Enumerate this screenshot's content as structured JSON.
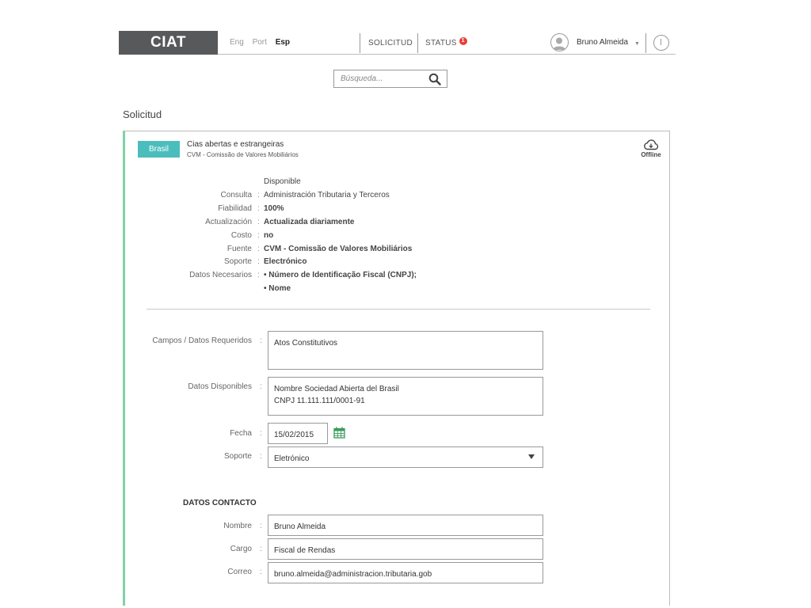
{
  "header": {
    "logo": "CIAT",
    "languages": [
      {
        "label": "Eng",
        "active": false
      },
      {
        "label": "Port",
        "active": false
      },
      {
        "label": "Esp",
        "active": true
      }
    ],
    "nav": {
      "solicitud": "SOLICITUD",
      "status": "STATUS",
      "status_badge": "1"
    },
    "user_name": "Bruno Almeida",
    "user_caret": "▼"
  },
  "search": {
    "placeholder": "Búsqueda..."
  },
  "page_title": "Solicitud",
  "card": {
    "country": "Brasil",
    "source_title": "Cias abertas e estrangeiras",
    "source_subtitle": "CVM - Comissão de Valores Mobiliários",
    "offline_label": "Offline",
    "availability": "Disponible",
    "details": [
      {
        "label": "Consulta",
        "value": "Administración Tributaria y Terceros",
        "bold": false
      },
      {
        "label": "Fiabilidad",
        "value": "100%",
        "bold": true
      },
      {
        "label": "Actualización",
        "value": "Actualizada diariamente",
        "bold": true
      },
      {
        "label": "Costo",
        "value": "no",
        "bold": true
      },
      {
        "label": "Fuente",
        "value": "CVM - Comissão de Valores Mobiliários",
        "bold": true
      },
      {
        "label": "Soporte",
        "value": "Electrónico",
        "bold": true
      },
      {
        "label": "Datos Necesarios",
        "value": "• Número de Identificação Fiscal (CNPJ);",
        "bold": true
      }
    ],
    "datos_necesarios_extra": "• Nome",
    "form": {
      "campos_label": "Campos / Datos Requeridos",
      "campos_value": "Atos Constitutivos",
      "disponibles_label": "Datos Disponibles",
      "disponibles_lines": [
        "Nombre  Sociedad Abierta del Brasil",
        "CNPJ  11.111.111/0001-91"
      ],
      "fecha_label": "Fecha",
      "fecha_value": "15/02/2015",
      "soporte_label": "Soporte",
      "soporte_value": "Eletrónico"
    },
    "contact": {
      "title": "DATOS CONTACTO",
      "nombre_label": "Nombre",
      "nombre_value": "Bruno Almeida",
      "cargo_label": "Cargo",
      "cargo_value": "Fiscal de Rendas",
      "correo_label": "Correo",
      "correo_value": "bruno.almeida@administracion.tributaria.gob"
    }
  },
  "colors": {
    "logo_bg": "#58595b",
    "country_tag": "#4bbdbd",
    "card_accent": "#7fd3a6",
    "badge": "#e5403a",
    "calendar_icon": "#3a9a5b"
  }
}
